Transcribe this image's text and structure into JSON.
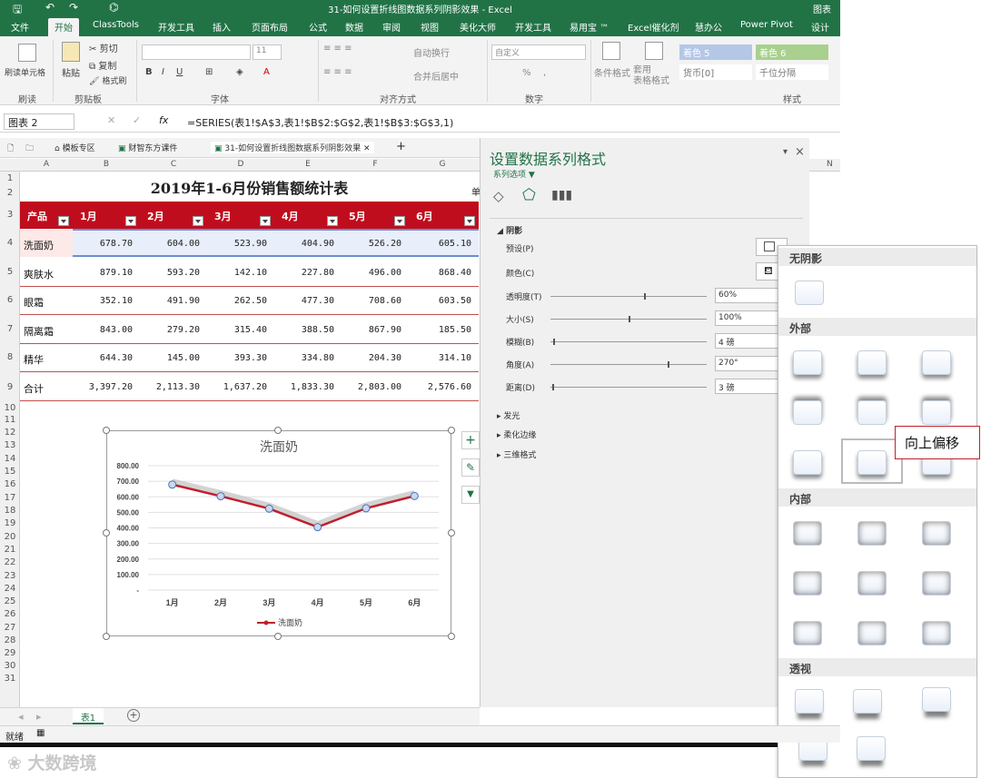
{
  "window": {
    "title": "31-如何设置折线图数据系列阴影效果 - Excel",
    "right_label": "图表"
  },
  "tabs": [
    "文件",
    "开始",
    "ClassTools",
    "开发工具",
    "插入",
    "页面布局",
    "公式",
    "数据",
    "审阅",
    "视图",
    "美化大师",
    "开发工具",
    "易用宝 ™",
    "Excel催化剂",
    "慧办公",
    "Power Pivot",
    "设计"
  ],
  "ribbon": {
    "clipboard": {
      "format_painter": "刷读单元格",
      "paste": "粘贴",
      "cut": "剪切",
      "copy": "复制",
      "format": "格式刷",
      "group1": "刷读",
      "group2": "剪贴板"
    },
    "font": {
      "size": "11",
      "group": "字体"
    },
    "align": {
      "wrap": "自动换行",
      "merge": "合并后居中",
      "group": "对齐方式"
    },
    "number": {
      "format": "自定义",
      "group": "数字",
      "pct": "%",
      "comma": ","
    },
    "styles": {
      "cond": "条件格式",
      "table": "套用\n表格格式",
      "s1": "着色 5",
      "s2": "着色 6",
      "s3": "货币[0]",
      "s4": "千位分隔",
      "group": "样式"
    }
  },
  "formula_bar": {
    "name_box": "图表 2",
    "fx": "fx",
    "formula": "=SERIES(表1!$A$3,表1!$B$2:$G$2,表1!$B$3:$G$3,1)"
  },
  "doc_tabs": [
    "模板专区",
    "财智东方课件",
    "31-如何设置折线图数据系列阴影效果"
  ],
  "columns": [
    "A",
    "B",
    "C",
    "D",
    "E",
    "F",
    "G",
    "N"
  ],
  "rows": [
    "1",
    "2",
    "3",
    "4",
    "5",
    "6",
    "7",
    "8",
    "9",
    "10",
    "11",
    "12",
    "13",
    "14",
    "15",
    "16",
    "17",
    "18",
    "19",
    "20",
    "21",
    "22",
    "23",
    "24",
    "25",
    "26",
    "27",
    "28",
    "29",
    "30",
    "31"
  ],
  "table": {
    "title": "2019年1-6月份销售额统计表",
    "corner_label": "单",
    "headers": [
      "产品",
      "1月",
      "2月",
      "3月",
      "4月",
      "5月",
      "6月"
    ],
    "rows": [
      {
        "name": "洗面奶",
        "values": [
          "678.70",
          "604.00",
          "523.90",
          "404.90",
          "526.20",
          "605.10"
        ]
      },
      {
        "name": "爽肤水",
        "values": [
          "879.10",
          "593.20",
          "142.10",
          "227.80",
          "496.00",
          "868.40"
        ]
      },
      {
        "name": "眼霜",
        "values": [
          "352.10",
          "491.90",
          "262.50",
          "477.30",
          "708.60",
          "603.50"
        ]
      },
      {
        "name": "隔离霜",
        "values": [
          "843.00",
          "279.20",
          "315.40",
          "388.50",
          "867.90",
          "185.50"
        ]
      },
      {
        "name": "精华",
        "values": [
          "644.30",
          "145.00",
          "393.30",
          "334.80",
          "204.30",
          "314.10"
        ]
      },
      {
        "name": "合计",
        "values": [
          "3,397.20",
          "2,113.30",
          "1,637.20",
          "1,833.30",
          "2,803.00",
          "2,576.60"
        ]
      }
    ]
  },
  "chart_data": {
    "type": "line",
    "title": "洗面奶",
    "categories": [
      "1月",
      "2月",
      "3月",
      "4月",
      "5月",
      "6月"
    ],
    "series": [
      {
        "name": "洗面奶",
        "values": [
          678.7,
          604.0,
          523.9,
          404.9,
          526.2,
          605.1
        ],
        "color": "#c0202b"
      }
    ],
    "ylim": [
      0,
      800
    ],
    "yticks": [
      "800.00",
      "700.00",
      "600.00",
      "500.00",
      "400.00",
      "300.00",
      "200.00",
      "100.00",
      "-"
    ],
    "legend": "bottom",
    "grid": true
  },
  "chart_buttons": [
    "+",
    "✎",
    "▼"
  ],
  "pane": {
    "title": "设置数据系列格式",
    "options": "系列选项 ▼",
    "close": "×",
    "shadow_section": "阴影",
    "props": [
      {
        "label": "预设(P)"
      },
      {
        "label": "颜色(C)"
      },
      {
        "label": "透明度(T)",
        "value": "60%",
        "level": 0.6
      },
      {
        "label": "大小(S)",
        "value": "100%",
        "level": 0.5
      },
      {
        "label": "模糊(B)",
        "value": "4 磅",
        "level": 0.02
      },
      {
        "label": "角度(A)",
        "value": "270°",
        "level": 0.75
      },
      {
        "label": "距离(D)",
        "value": "3 磅",
        "level": 0.01
      }
    ],
    "sections": [
      "发光",
      "柔化边缘",
      "三维格式"
    ]
  },
  "gallery": {
    "groups": [
      "无阴影",
      "外部",
      "内部",
      "透视"
    ],
    "tooltip": "向上偏移"
  },
  "sheet_tab": "表1",
  "status": "就绪",
  "watermark": "大数跨境",
  "colors": {
    "excel_green": "#217346",
    "header_red": "#c00d1e",
    "row_line": "#c0504d",
    "tooltip_border": "#c0202b"
  }
}
